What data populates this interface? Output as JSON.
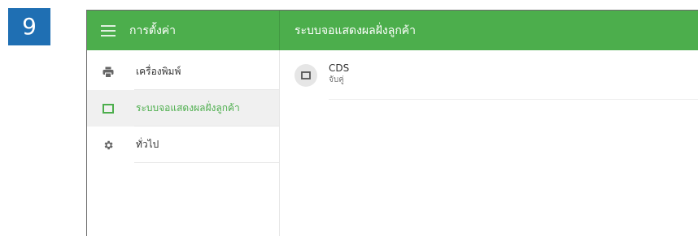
{
  "step": {
    "number": "9"
  },
  "header": {
    "settings_title": "การตั้งค่า",
    "section_title": "ระบบจอแสดงผลฝั่งลูกค้า"
  },
  "sidebar": {
    "items": [
      {
        "label": "เครื่องพิมพ์",
        "icon": "printer-icon",
        "active": false
      },
      {
        "label": "ระบบจอแสดงผลฝั่งลูกค้า",
        "icon": "display-icon",
        "active": true
      },
      {
        "label": "ทั่วไป",
        "icon": "gear-icon",
        "active": false
      }
    ]
  },
  "devices": [
    {
      "name": "CDS",
      "status": "จับคู่",
      "icon": "display-icon"
    }
  ],
  "colors": {
    "accent": "#4cae4c",
    "badge": "#1f6fb3",
    "active_bg": "#f0f0f0"
  }
}
